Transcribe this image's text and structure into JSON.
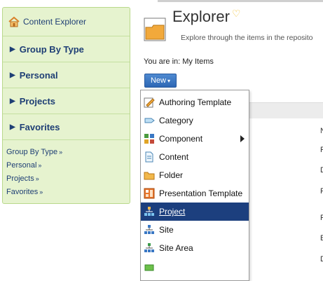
{
  "sidebar": {
    "header_label": "Content Explorer",
    "sections": [
      {
        "label": "Group By Type"
      },
      {
        "label": "Personal"
      },
      {
        "label": "Projects"
      },
      {
        "label": "Favorites"
      }
    ],
    "links": [
      {
        "label": "Group By Type",
        "chevron": "»"
      },
      {
        "label": "Personal",
        "chevron": "»"
      },
      {
        "label": "Projects",
        "chevron": "»"
      },
      {
        "label": "Favorites",
        "chevron": "»"
      }
    ]
  },
  "header": {
    "title": "Explorer",
    "heart_glyph": "♡",
    "subtitle": "Explore through the items in the reposito",
    "breadcrumb": "You are in:  My Items"
  },
  "new_button": {
    "label": "New",
    "caret": "▾"
  },
  "table_glimpse": {
    "letters": [
      "N",
      "F",
      "D",
      "F",
      "F",
      "E",
      "D"
    ]
  },
  "menu": {
    "items": [
      {
        "label": "Authoring Template",
        "icon": "authoring-template-icon"
      },
      {
        "label": "Category",
        "icon": "category-icon"
      },
      {
        "label": "Component",
        "icon": "component-icon",
        "submenu": true
      },
      {
        "label": "Content",
        "icon": "content-icon"
      },
      {
        "label": "Folder",
        "icon": "folder-icon"
      },
      {
        "label": "Presentation Template",
        "icon": "presentation-template-icon"
      },
      {
        "label": "Project",
        "icon": "project-icon",
        "selected": true
      },
      {
        "label": "Site",
        "icon": "site-icon"
      },
      {
        "label": "Site Area",
        "icon": "site-area-icon"
      }
    ]
  },
  "colors": {
    "sidebar_bg": "#e6f3cf",
    "accent_blue": "#1c3f7e",
    "button_blue": "#2d67b5"
  }
}
